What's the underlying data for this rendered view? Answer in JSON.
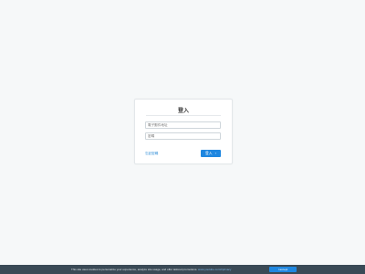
{
  "login": {
    "title": "登入",
    "username_placeholder": "電子郵件地址",
    "password_placeholder": "密碼",
    "forgot_password": "忘記密碼",
    "submit": "登入"
  },
  "cookie_bar": {
    "text": "This site uses cookies to personalize your experience, analyze site usage, and offer tailored promotions.",
    "link": "www.youtube.com/t/privacy",
    "accept": "I accept"
  },
  "icons": {
    "submit_chevron": "chevron-right-icon"
  },
  "colors": {
    "accent": "#1f87e0",
    "background": "#f6f8f9",
    "cookie_bar": "#3a4a56"
  }
}
